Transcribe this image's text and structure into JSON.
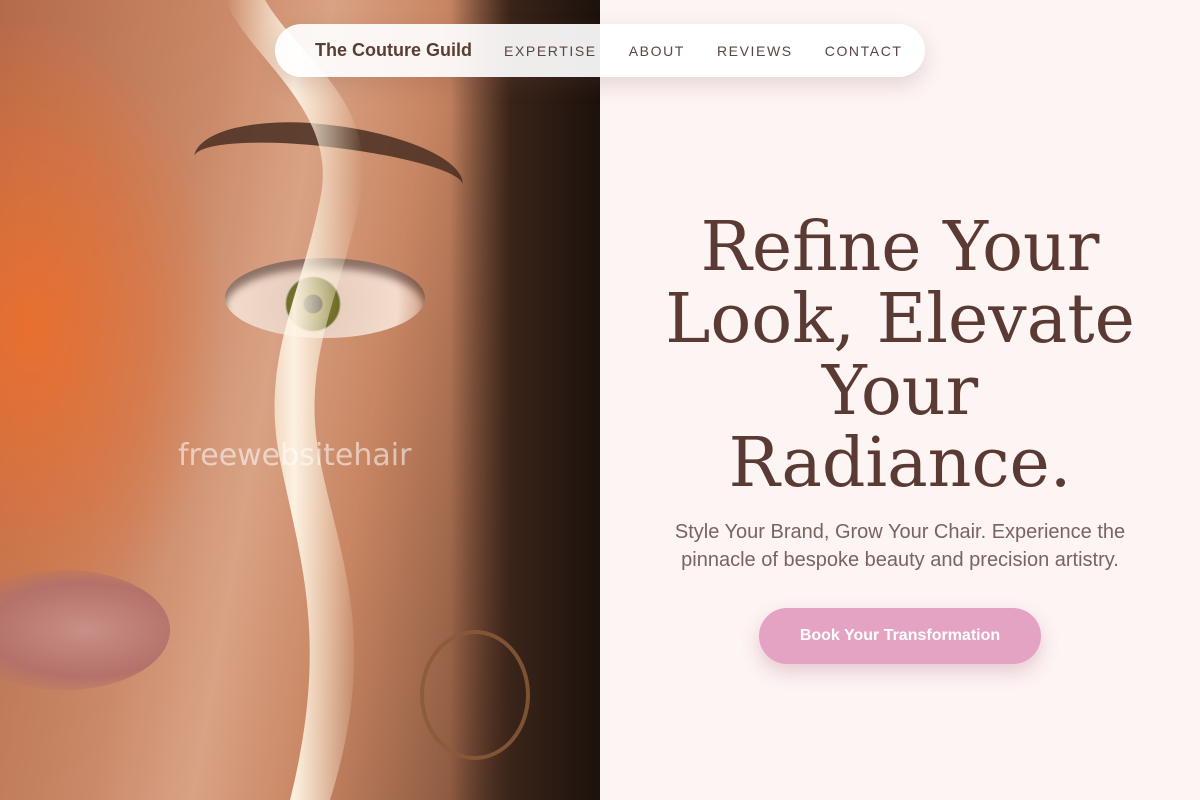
{
  "nav": {
    "brand": "The Couture Guild",
    "links": [
      "EXPERTISE",
      "ABOUT",
      "REVIEWS",
      "CONTACT"
    ]
  },
  "hero": {
    "headline": "Refine Your Look, Elevate Your Radiance.",
    "subhead": "Style Your Brand, Grow Your Chair. Experience the pinnacle of bespoke beauty and precision artistry.",
    "cta_label": "Book Your Transformation",
    "watermark": "freewebsitehair"
  },
  "colors": {
    "background": "#fdf4f4",
    "headline": "#5a3a32",
    "cta": "#e4a3c3",
    "nav_text": "#5a4540"
  }
}
